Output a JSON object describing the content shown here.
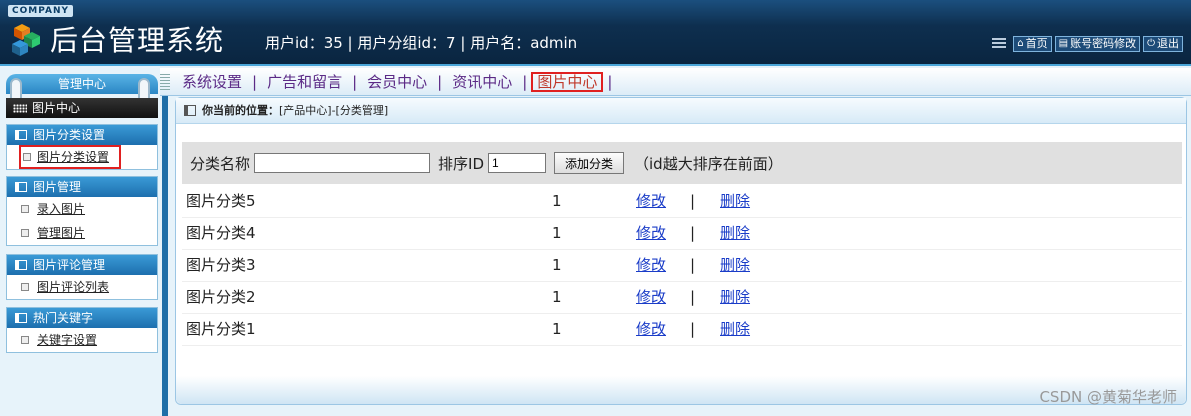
{
  "header": {
    "company": "COMPANY",
    "title": "后台管理系统",
    "user_info": "用户id：35 | 用户分组id：7 | 用户名：admin",
    "tools": [
      {
        "label": "首页",
        "icon": "home-icon"
      },
      {
        "label": "账号密码修改",
        "icon": "document-icon"
      },
      {
        "label": "退出",
        "icon": "power-icon"
      }
    ]
  },
  "nav": {
    "items": [
      "系统设置",
      "广告和留言",
      "会员中心",
      "资讯中心",
      "图片中心"
    ],
    "active_index": 4
  },
  "sidebar": {
    "head": "管理中心",
    "section_title": "图片中心",
    "groups": [
      {
        "title": "图片分类设置",
        "links": [
          "图片分类设置"
        ]
      },
      {
        "title": "图片管理",
        "links": [
          "录入图片",
          "管理图片"
        ]
      },
      {
        "title": "图片评论管理",
        "links": [
          "图片评论列表"
        ]
      },
      {
        "title": "热门关键字",
        "links": [
          "关键字设置"
        ]
      }
    ]
  },
  "main": {
    "breadcrumb_label": "你当前的位置：",
    "breadcrumb_path": "[产品中心]-[分类管理]",
    "form": {
      "name_label": "分类名称",
      "name_value": "",
      "order_label": "排序ID",
      "order_value": "1",
      "add_button": "添加分类",
      "hint": "（id越大排序在前面）"
    },
    "rows": [
      {
        "name": "图片分类5",
        "order": "1",
        "edit": "修改",
        "sep": "|",
        "delete": "删除"
      },
      {
        "name": "图片分类4",
        "order": "1",
        "edit": "修改",
        "sep": "|",
        "delete": "删除"
      },
      {
        "name": "图片分类3",
        "order": "1",
        "edit": "修改",
        "sep": "|",
        "delete": "删除"
      },
      {
        "name": "图片分类2",
        "order": "1",
        "edit": "修改",
        "sep": "|",
        "delete": "删除"
      },
      {
        "name": "图片分类1",
        "order": "1",
        "edit": "修改",
        "sep": "|",
        "delete": "删除"
      }
    ]
  },
  "watermark": "CSDN @黄菊华老师",
  "colors": {
    "header_bg": "#0e2f4f",
    "accent": "#1f6ea7",
    "highlight": "#e02020",
    "link": "#1a3cc8"
  }
}
